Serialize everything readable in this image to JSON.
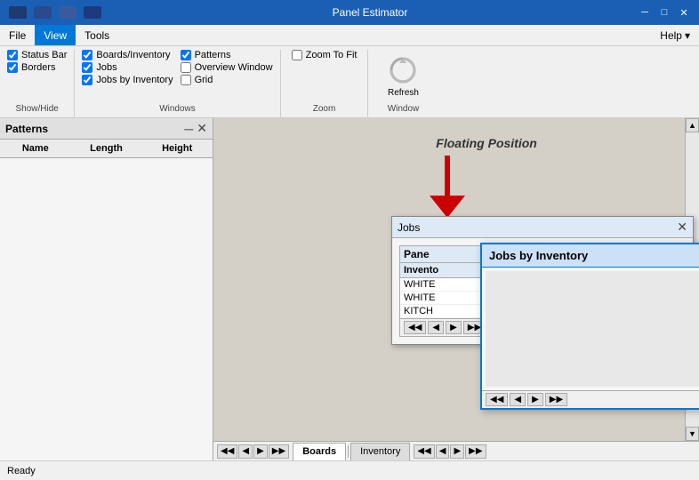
{
  "titleBar": {
    "title": "Panel Estimator",
    "minimizeLabel": "─",
    "maximizeLabel": "□",
    "closeLabel": "✕"
  },
  "menu": {
    "items": [
      "File",
      "View",
      "Tools"
    ],
    "activeItem": "View",
    "helpLabel": "Help",
    "helpArrow": "▾"
  },
  "ribbon": {
    "showHideGroup": {
      "label": "Show/Hide",
      "items": [
        {
          "id": "status-bar",
          "label": "Status Bar",
          "checked": true
        },
        {
          "id": "borders",
          "label": "Borders",
          "checked": true
        }
      ]
    },
    "windowsGroup": {
      "label": "Windows",
      "col1": [
        {
          "id": "boards-inventory",
          "label": "Boards/Inventory",
          "checked": true
        },
        {
          "id": "jobs",
          "label": "Jobs",
          "checked": true
        },
        {
          "id": "jobs-by-inventory",
          "label": "Jobs by Inventory",
          "checked": true
        }
      ],
      "col2": [
        {
          "id": "patterns",
          "label": "Patterns",
          "checked": true
        },
        {
          "id": "overview-window",
          "label": "Overview Window",
          "checked": false
        },
        {
          "id": "grid",
          "label": "Grid",
          "checked": false
        }
      ]
    },
    "zoomGroup": {
      "label": "Zoom",
      "zoomToFitLabel": "Zoom To Fit"
    },
    "windowGroup": {
      "label": "Window",
      "refreshLabel": "Refresh"
    }
  },
  "patternsPanel": {
    "title": "Patterns",
    "pinLabel": "─",
    "closeLabel": "✕",
    "columns": [
      "Name",
      "Length",
      "Height"
    ]
  },
  "canvasArea": {
    "floatingLabel": "Floating Position"
  },
  "jobsWindow": {
    "title": "Jobs",
    "closeLabel": "✕",
    "panelTitle": "Pane",
    "columns": [
      "Invento"
    ],
    "rows": [
      "WHITE",
      "WHITE",
      "KITCH"
    ],
    "navFirst": "◀◀",
    "navPrev": "◀",
    "navNext": "▶",
    "navLast": "▶▶"
  },
  "jobsByInventoryWindow": {
    "title": "Jobs by Inventory",
    "closeLabel": "✕",
    "navFirst": "◀◀",
    "navPrev": "◀",
    "navNext": "▶",
    "navLast": "▶▶"
  },
  "bottomTabs": {
    "navFirst": "◀◀",
    "navPrev": "◀",
    "navNext": "▶",
    "navLast": "▶▶",
    "tab1": "Boards",
    "tab2": "Inventory",
    "navFirst2": "◀◀",
    "navPrev2": "◀",
    "navNext2": "▶",
    "navLast2": "▶▶"
  },
  "statusBar": {
    "text": "Ready"
  }
}
